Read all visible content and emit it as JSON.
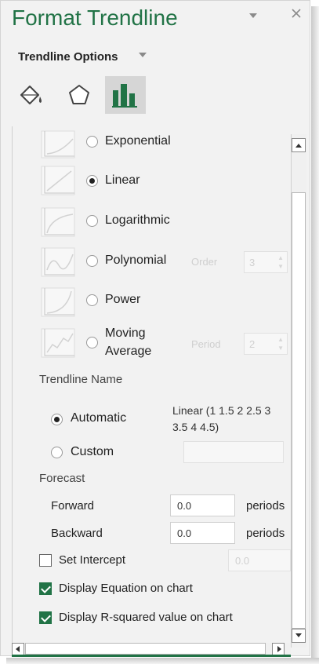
{
  "pane": {
    "title": "Format Trendline",
    "menu_icon": "dropdown-caret-icon",
    "close_icon": "close-icon",
    "options_title": "Trendline Options",
    "tabs": [
      {
        "name": "fill-line",
        "icon": "paint-bucket-icon"
      },
      {
        "name": "effects",
        "icon": "pentagon-icon"
      },
      {
        "name": "trendline-options",
        "icon": "bar-chart-icon",
        "selected": true
      }
    ]
  },
  "trend_types": [
    {
      "label": "Exponential",
      "selected": false
    },
    {
      "label": "Linear",
      "selected": true
    },
    {
      "label": "Logarithmic",
      "selected": false
    },
    {
      "label": "Polynomial",
      "selected": false,
      "param_label": "Order",
      "param_value": "3"
    },
    {
      "label": "Power",
      "selected": false
    },
    {
      "label": "Moving",
      "label2": "Average",
      "selected": false,
      "param_label": "Period",
      "param_value": "2"
    }
  ],
  "trendline_name": {
    "section": "Trendline Name",
    "automatic_label": "Automatic",
    "automatic_value_line1": "Linear (1 1.5 2 2.5 3",
    "automatic_value_line2": "3.5 4 4.5)",
    "custom_label": "Custom",
    "selected": "automatic"
  },
  "forecast": {
    "section": "Forecast",
    "forward_label": "Forward",
    "forward_value": "0.0",
    "backward_label": "Backward",
    "backward_value": "0.0",
    "unit": "periods"
  },
  "options": {
    "set_intercept_label": "Set Intercept",
    "set_intercept_checked": false,
    "intercept_value": "0.0",
    "display_equation_label": "Display Equation on chart",
    "display_equation_checked": true,
    "display_r2_label": "Display R-squared value on chart",
    "display_r2_checked": true
  },
  "colors": {
    "accent": "#217346",
    "pane_bg": "#f2f2f2"
  }
}
